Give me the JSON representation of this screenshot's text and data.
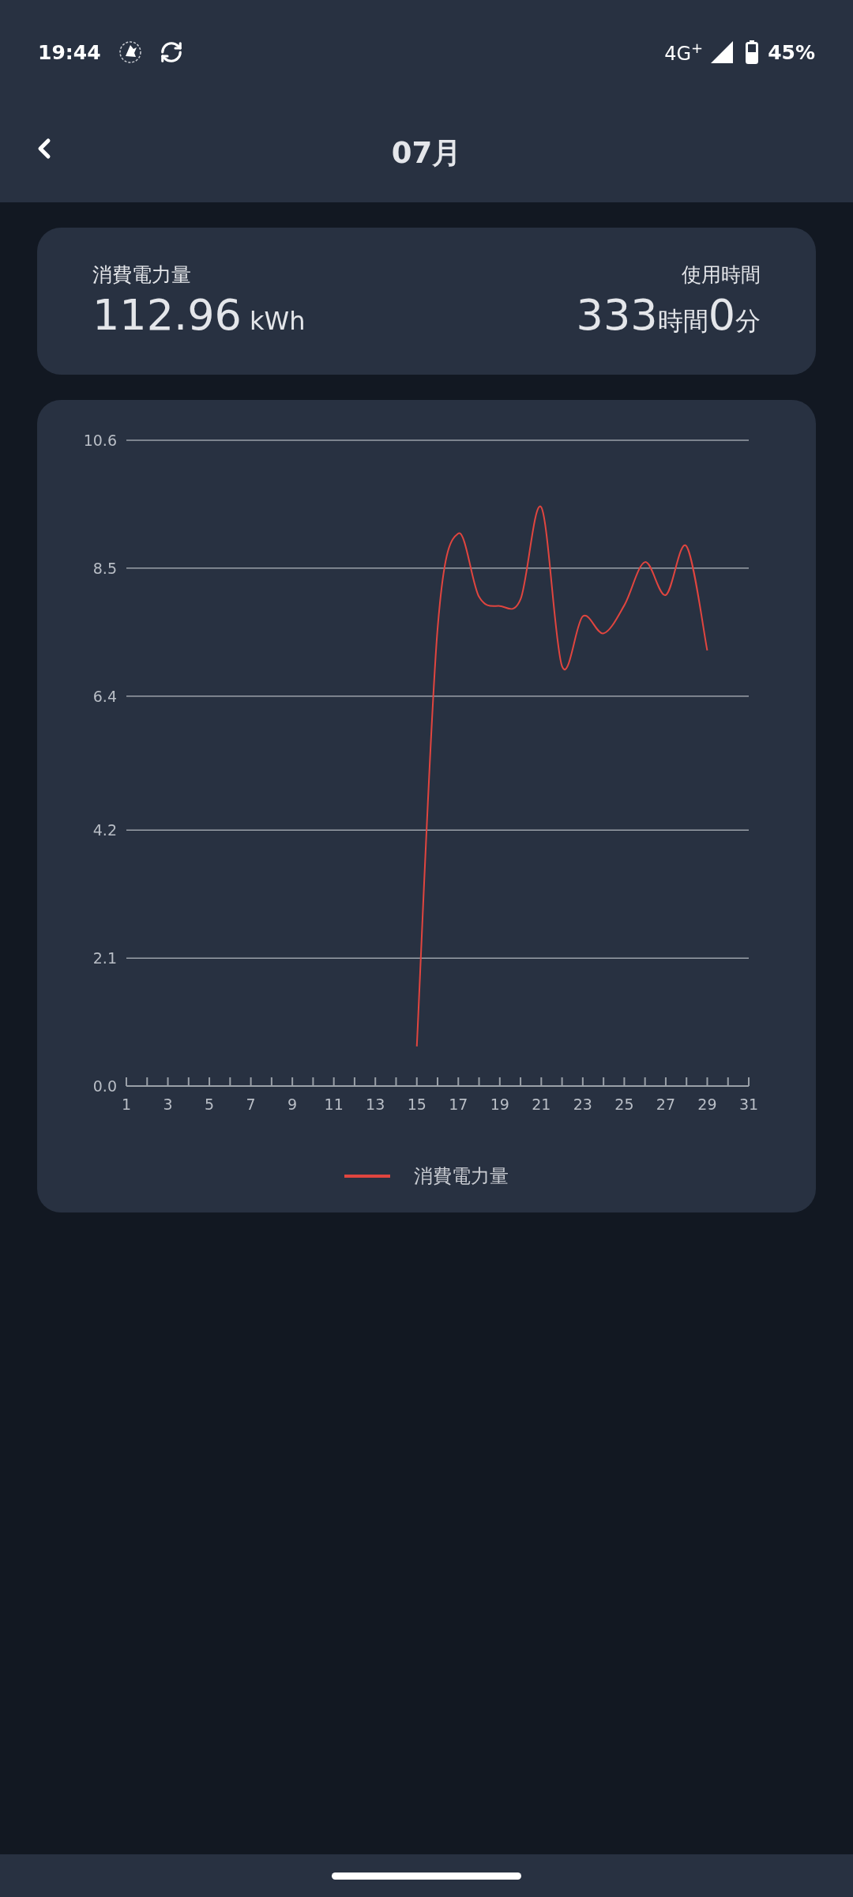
{
  "status_bar": {
    "time": "19:44",
    "network": "4G$^{+}$",
    "battery": "45%"
  },
  "app_bar": {
    "title": "07月"
  },
  "summary": [
    {
      "kind": "energy",
      "label": "消費電力量",
      "parts": [
        {
          "kind": "number",
          "text": "112.96"
        },
        {
          "kind": "unit",
          "text": "kWh"
        }
      ]
    },
    {
      "kind": "time",
      "label": "使用時間",
      "parts": [
        {
          "kind": "number",
          "text": "333"
        },
        {
          "kind": "unit",
          "text": "時間"
        },
        {
          "kind": "number",
          "text": "0"
        },
        {
          "kind": "unit",
          "text": "分"
        }
      ]
    }
  ],
  "chart_data": {
    "type": "line",
    "grid": true,
    "x": [
      15,
      16,
      17,
      18,
      19,
      20,
      21,
      22,
      23,
      24,
      25,
      26,
      27,
      28,
      29
    ],
    "series": [
      {
        "name": "消費電力量",
        "color": "#e0453f",
        "values": [
          0.65,
          7.5,
          9.07,
          8.03,
          7.88,
          7.99,
          9.5,
          6.89,
          7.71,
          7.43,
          7.89,
          8.6,
          8.06,
          8.86,
          7.15
        ]
      }
    ],
    "xlim": [
      1,
      31
    ],
    "ylim": [
      0,
      10.6
    ],
    "xticks": [
      1,
      3,
      5,
      7,
      9,
      11,
      13,
      15,
      17,
      19,
      21,
      23,
      25,
      27,
      29,
      31
    ],
    "yticks": [
      {
        "value": 0,
        "label": "0.0"
      },
      2.1,
      4.2,
      6.4,
      8.5,
      10.6
    ]
  }
}
